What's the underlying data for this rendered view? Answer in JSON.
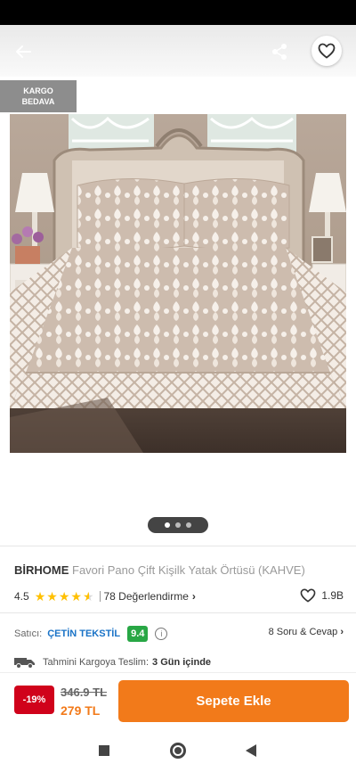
{
  "header": {
    "back_icon": "arrow-left-icon",
    "share_icon": "share-icon",
    "favorite_icon": "heart-outline-icon"
  },
  "gallery": {
    "badge_line1": "KARGO",
    "badge_line2": "BEDAVA",
    "image_alt": "Bedspread on bed",
    "page_count": 3,
    "active_page": 1
  },
  "product": {
    "brand": "BİRHOME",
    "name": "Favori Pano Çift Kişilk Yatak Örtüsü (KAHVE)",
    "rating": "4.5",
    "rating_value": 4.5,
    "reviews": "78 Değerlendirme",
    "favorites": "1.9B"
  },
  "seller": {
    "label": "Satıcı:",
    "name": "ÇETİN TEKSTİL",
    "score": "9.4",
    "qa_link": "8 Soru & Cevap"
  },
  "delivery": {
    "label": "Tahmini Kargoya Teslim:",
    "value": "3 Gün içinde"
  },
  "pricing": {
    "discount": "-19%",
    "old_price": "346.9 TL",
    "new_price": "279 TL",
    "cart_button": "Sepete Ekle"
  },
  "colors": {
    "accent": "#f27a1a",
    "discount": "#d0021b",
    "seller_link": "#1a73c7",
    "score_badge": "#28a745"
  }
}
